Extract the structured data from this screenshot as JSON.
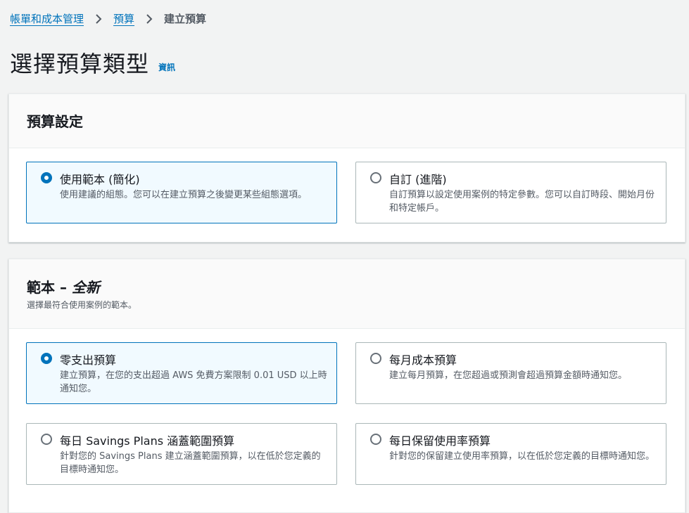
{
  "breadcrumb": {
    "items": [
      "帳單和成本管理",
      "預算"
    ],
    "current": "建立預算"
  },
  "page": {
    "title": "選擇預算類型",
    "info": "資訊"
  },
  "budget_setup": {
    "title": "預算設定",
    "options": [
      {
        "label": "使用範本 (簡化)",
        "description": "使用建議的組態。您可以在建立預算之後變更某些組態選項。",
        "selected": true
      },
      {
        "label": "自訂 (進階)",
        "description": "自訂預算以設定使用案例的特定參數。您可以自訂時段、開始月份和特定帳戶。",
        "selected": false
      }
    ]
  },
  "templates": {
    "title_prefix": "範本 – ",
    "title_new": "全新",
    "description": "選擇最符合使用案例的範本。",
    "options": [
      {
        "label": "零支出預算",
        "description": "建立預算，在您的支出超過 AWS 免費方案限制 0.01 USD 以上時通知您。",
        "selected": true
      },
      {
        "label": "每月成本預算",
        "description": "建立每月預算，在您超過或預測會超過預算金額時通知您。",
        "selected": false
      },
      {
        "label": "每日 Savings Plans 涵蓋範圍預算",
        "description": "針對您的 Savings Plans 建立涵蓋範圍預算，以在低於您定義的目標時通知您。",
        "selected": false
      },
      {
        "label": "每日保留使用率預算",
        "description": "針對您的保留建立使用率預算，以在低於您定義的目標時通知您。",
        "selected": false
      }
    ]
  },
  "colors": {
    "accent": "#0073bb",
    "selected_bg": "#f1faff",
    "page_bg": "#f2f3f3"
  }
}
